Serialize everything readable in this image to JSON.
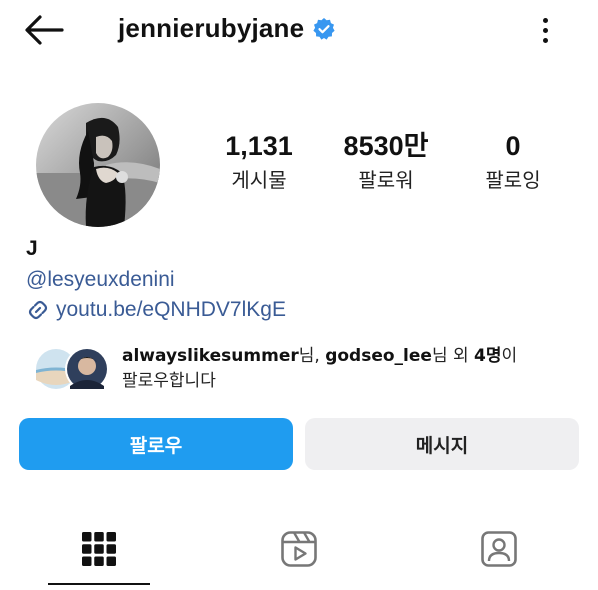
{
  "header": {
    "username": "jennierubyjane",
    "back_icon": "arrow-left-icon",
    "verified_icon": "verified-badge-icon",
    "more_icon": "more-vertical-icon",
    "verified_color": "#3897f0"
  },
  "stats": [
    {
      "value": "1,131",
      "label": "게시물"
    },
    {
      "value": "8530만",
      "label": "팔로워"
    },
    {
      "value": "0",
      "label": "팔로잉"
    }
  ],
  "bio": {
    "name": "J",
    "tag": "@lesyeuxdenini",
    "link_icon": "link-icon",
    "link": "youtu.be/eQNHDV7lKgE"
  },
  "followed_by": {
    "user1": "alwayslikesummer",
    "sep1": "님, ",
    "user2": "godseo_lee",
    "sep2": "님 외 ",
    "count": "4명",
    "tail": "이",
    "line2": "팔로우합니다"
  },
  "actions": {
    "follow_label": "팔로우",
    "message_label": "메시지",
    "follow_color": "#1f9cf0"
  },
  "tabs": [
    {
      "icon": "grid-icon",
      "active": true
    },
    {
      "icon": "reels-icon",
      "active": false
    },
    {
      "icon": "tagged-user-icon",
      "active": false
    }
  ]
}
